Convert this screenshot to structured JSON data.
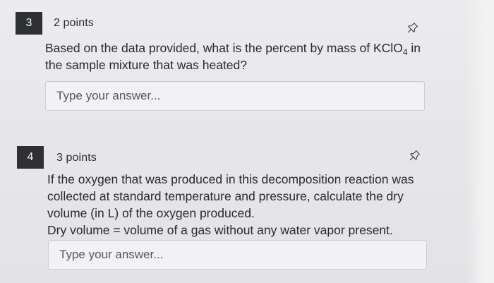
{
  "questions": [
    {
      "number": "3",
      "points": "2 points",
      "text_line1_pre": "Based on the data provided, what is the percent by mass of KClO",
      "text_line1_sub": "4",
      "text_line1_post": " in",
      "text_line2": "the sample mixture that was heated?",
      "answer_placeholder": "Type your answer...",
      "pin_icon": "pin-icon"
    },
    {
      "number": "4",
      "points": "3 points",
      "text_lines": [
        "If the oxygen that was produced in this decomposition reaction was",
        "collected at standard temperature and pressure, calculate the dry",
        "volume (in L) of the oxygen produced.",
        "Dry volume = volume of a gas without any water vapor present."
      ],
      "answer_placeholder": "Type your answer...",
      "pin_icon": "pin-icon"
    }
  ]
}
